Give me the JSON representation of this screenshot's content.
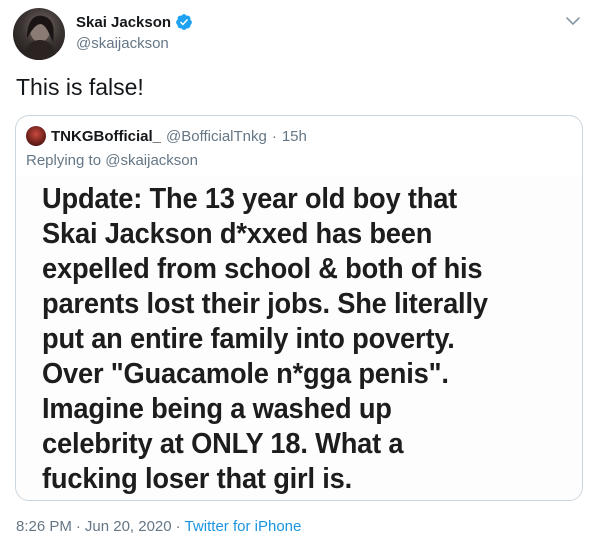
{
  "author": {
    "name": "Skai Jackson",
    "handle": "@skaijackson",
    "verified": true
  },
  "tweet": {
    "text": "This is false!"
  },
  "quoted_tweet": {
    "name": "TNKGBofficial_",
    "handle": "@BofficialTnkg",
    "separator": "·",
    "time": "15h",
    "replying_prefix": "Replying to",
    "replying_to": "@skaijackson",
    "image_text_lines": [
      "Update: The 13 year old boy that",
      "Skai Jackson d*xxed has been",
      "expelled from school & both of his",
      "parents lost their jobs. She literally",
      "put an entire family into poverty.",
      "Over \"Guacamole n*gga penis\".",
      "Imagine being a washed up",
      "celebrity at ONLY 18. What a",
      "fucking loser that girl is."
    ]
  },
  "meta": {
    "time": "8:26 PM",
    "separator1": "·",
    "date": "Jun 20, 2020",
    "separator2": "·",
    "source": "Twitter for iPhone"
  },
  "icons": {
    "verified": "verified-badge-icon",
    "caret": "chevron-down-icon"
  },
  "colors": {
    "text": "#14171a",
    "secondary": "#657786",
    "link": "#1b95e0",
    "verified": "#1da1f2",
    "border": "#ccd6dd"
  }
}
